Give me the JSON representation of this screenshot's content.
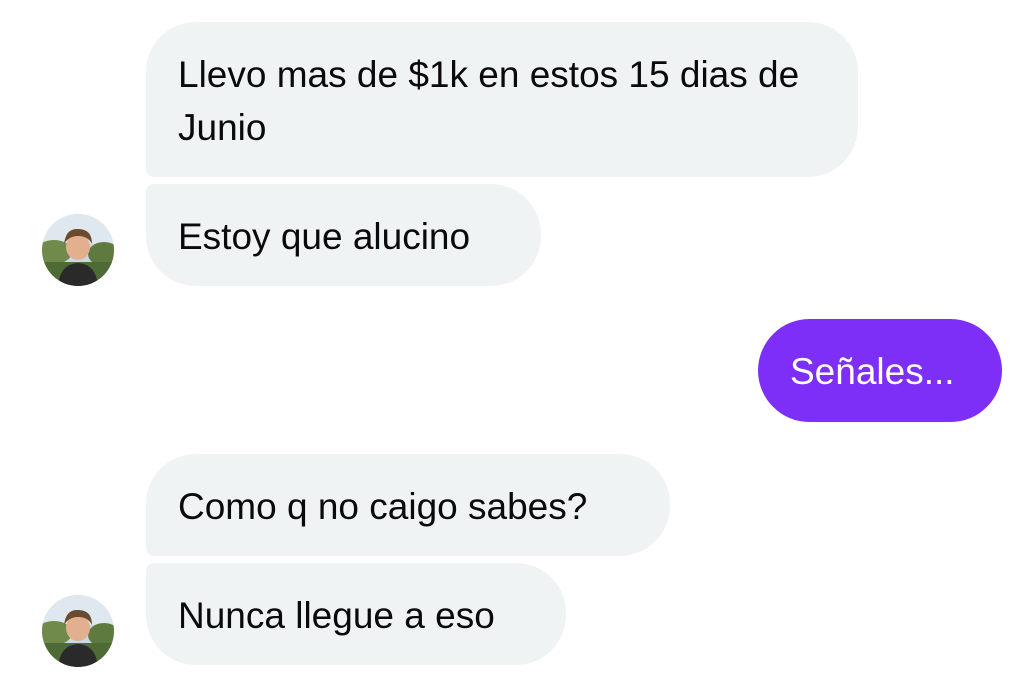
{
  "messages": [
    {
      "direction": "incoming",
      "text": "Llevo mas de $1k en estos 15 dias de Junio"
    },
    {
      "direction": "incoming",
      "text": "Estoy que alucino"
    },
    {
      "direction": "outgoing",
      "text": "Señales..."
    },
    {
      "direction": "incoming",
      "text": "Como q no caigo sabes?"
    },
    {
      "direction": "incoming",
      "text": "Nunca llegue a eso"
    }
  ],
  "colors": {
    "incoming_bubble": "#f0f3f4",
    "outgoing_bubble": "#7d2ff7",
    "incoming_text": "#0a0a0a",
    "outgoing_text": "#ffffff"
  },
  "avatar": {
    "icon": "user-avatar-photo"
  }
}
